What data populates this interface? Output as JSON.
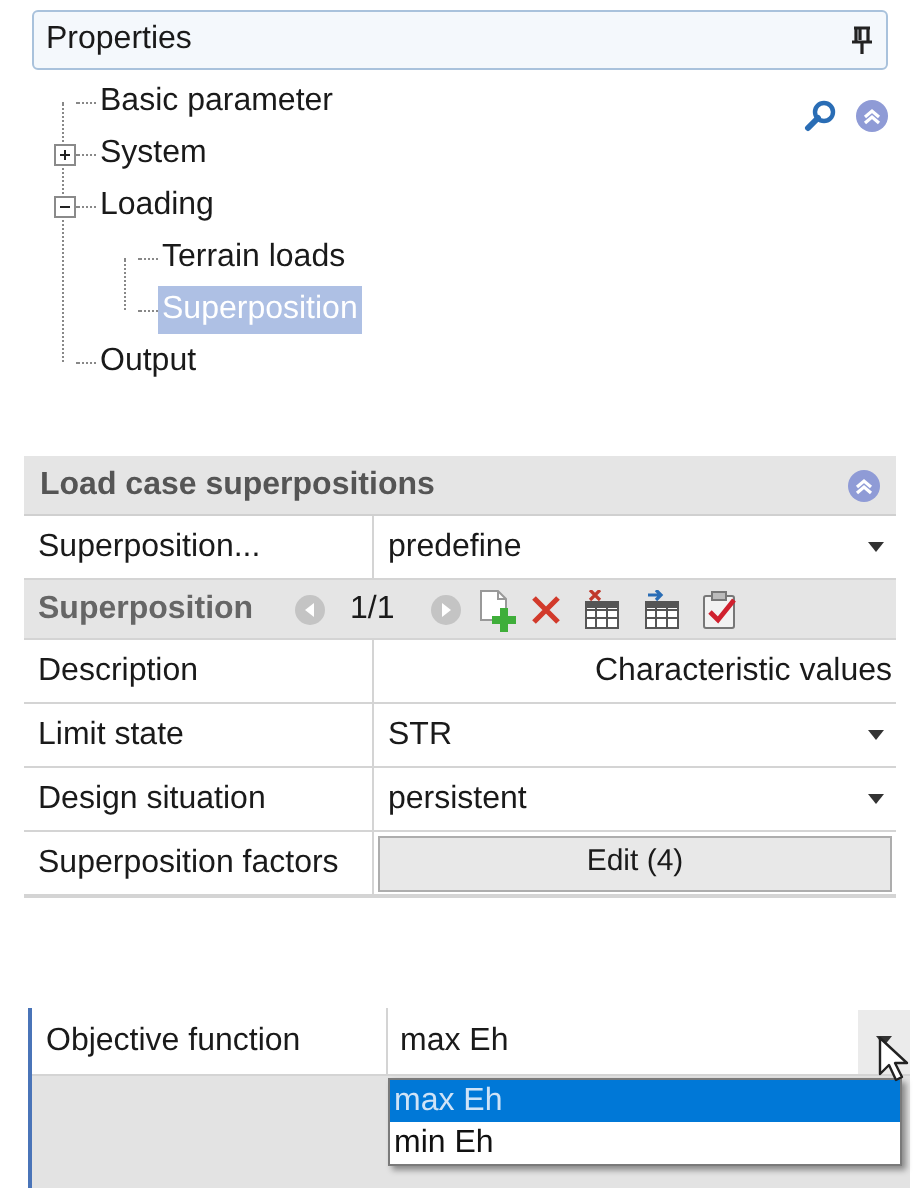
{
  "panel": {
    "title": "Properties"
  },
  "tree": [
    {
      "kind": "leaf",
      "label": "Basic parameter",
      "expanded": false,
      "selected": false
    },
    {
      "kind": "node",
      "label": "System",
      "expanded": false,
      "selected": false
    },
    {
      "kind": "node",
      "label": "Loading",
      "expanded": true,
      "selected": false,
      "children": [
        {
          "kind": "leaf",
          "label": "Terrain loads",
          "expanded": false,
          "selected": false
        },
        {
          "kind": "leaf",
          "label": "Superposition",
          "expanded": false,
          "selected": true
        }
      ]
    },
    {
      "kind": "leaf",
      "label": "Output",
      "expanded": false,
      "selected": false
    }
  ],
  "section": {
    "title": "Load case superpositions",
    "rows": [
      {
        "kind": "dropdown",
        "label": "Superposition...",
        "value": "predefine"
      },
      {
        "kind": "toolbar",
        "label": "Superposition",
        "counter": "1/1"
      },
      {
        "kind": "text",
        "label": "Description",
        "value": "Characteristic values"
      },
      {
        "kind": "dropdown",
        "label": "Limit state",
        "value": "STR"
      },
      {
        "kind": "dropdown",
        "label": "Design situation",
        "value": "persistent"
      },
      {
        "kind": "button",
        "label": "Superposition factors",
        "value": "Edit (4)"
      }
    ]
  },
  "objective": {
    "label": "Objective function",
    "value": "max Eh",
    "options": [
      {
        "label": "max Eh",
        "selected": true
      },
      {
        "label": "min Eh",
        "selected": false
      }
    ]
  }
}
